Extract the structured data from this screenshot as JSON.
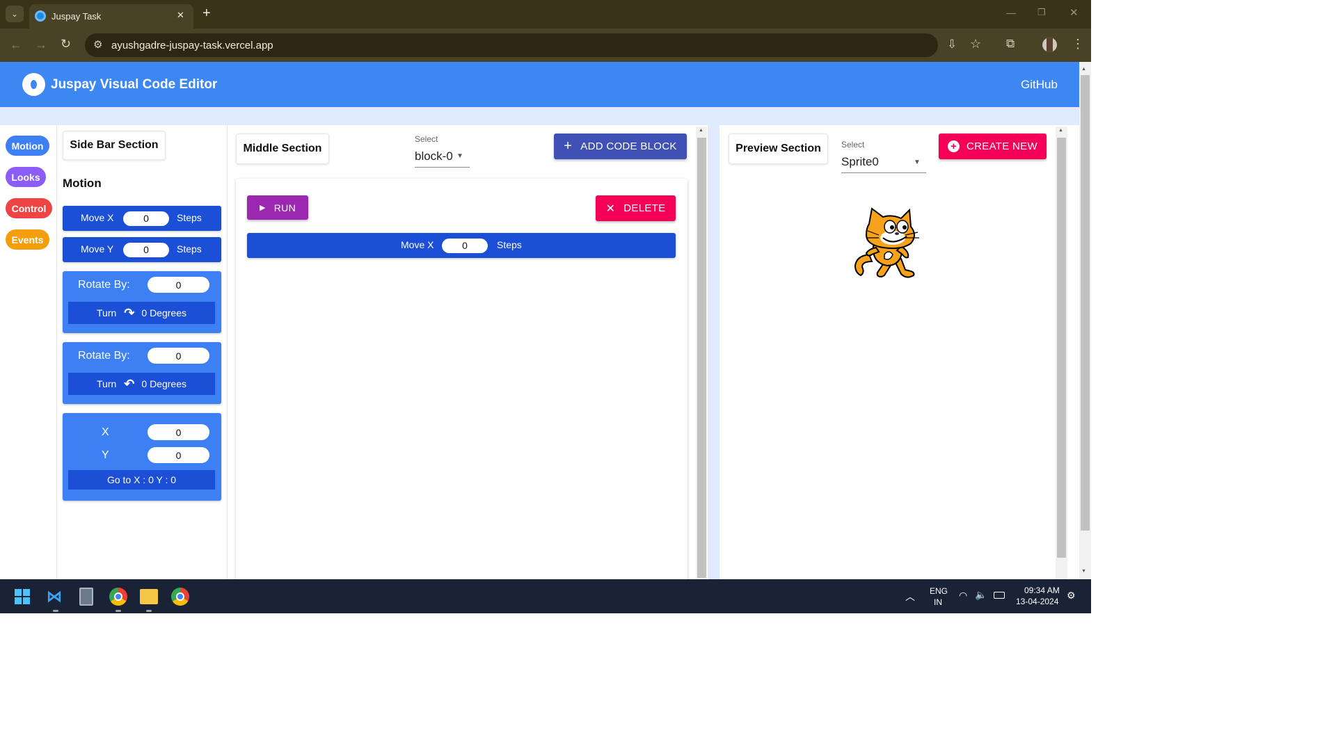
{
  "browser": {
    "tab_title": "Juspay Task",
    "url": "ayushgadre-juspay-task.vercel.app",
    "close_tab": "✕",
    "new_tab": "+"
  },
  "header": {
    "title": "Juspay Visual Code Editor",
    "github_link": "GitHub"
  },
  "categories": [
    {
      "label": "Motion",
      "color": "#3c80f3"
    },
    {
      "label": "Looks",
      "color": "#8b5cf6"
    },
    {
      "label": "Control",
      "color": "#ef4444"
    },
    {
      "label": "Events",
      "color": "#f59e0b"
    }
  ],
  "sidebar": {
    "section_title": "Side Bar Section",
    "heading": "Motion",
    "move_x": {
      "label": "Move X",
      "value": "0",
      "unit": "Steps"
    },
    "move_y": {
      "label": "Move Y",
      "value": "0",
      "unit": "Steps"
    },
    "rotate_cw": {
      "label": "Rotate By:",
      "value": "0",
      "turn": "Turn",
      "degrees": "0 Degrees"
    },
    "rotate_ccw": {
      "label": "Rotate By:",
      "value": "0",
      "turn": "Turn",
      "degrees": "0 Degrees"
    },
    "goto": {
      "x_label": "X",
      "x_value": "0",
      "y_label": "Y",
      "y_value": "0",
      "button": "Go to X : 0 Y : 0"
    }
  },
  "middle": {
    "section_title": "Middle Section",
    "select_label": "Select",
    "select_value": "block-0",
    "add_button": "ADD CODE BLOCK",
    "run_button": "RUN",
    "delete_button": "DELETE",
    "block": {
      "label": "Move X",
      "value": "0",
      "unit": "Steps"
    }
  },
  "preview": {
    "section_title": "Preview Section",
    "select_label": "Select",
    "select_value": "Sprite0",
    "create_button": "CREATE NEW"
  },
  "taskbar": {
    "lang_top": "ENG",
    "lang_bottom": "IN",
    "time": "09:34 AM",
    "date": "13-04-2024"
  },
  "colors": {
    "app_blue": "#3c87f1",
    "block_blue": "#1a4fd6",
    "run_purple": "#9c27b0",
    "delete_pink": "#f50057",
    "add_indigo": "#3f51b5"
  }
}
